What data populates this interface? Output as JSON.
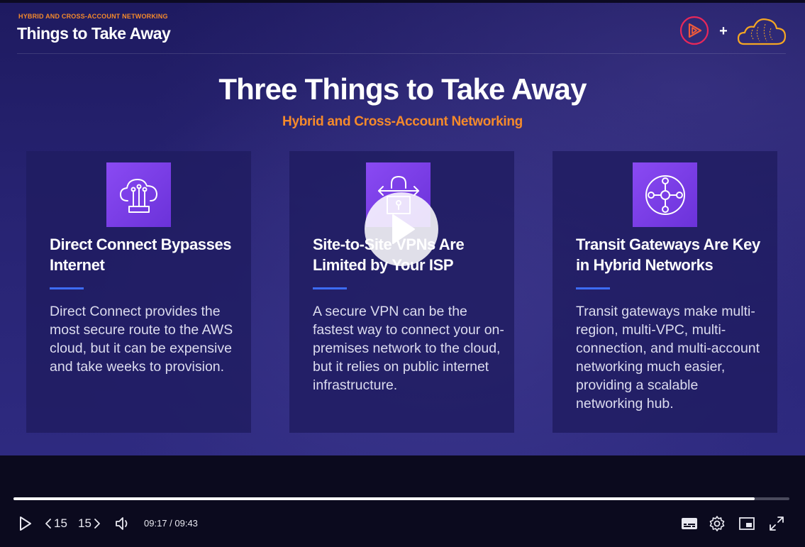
{
  "header": {
    "kicker": "HYBRID AND CROSS-ACCOUNT NETWORKING",
    "title": "Things to Take Away",
    "plus": "+",
    "logos": [
      "play-logo-icon",
      "cloud-logo-icon"
    ]
  },
  "slide": {
    "title": "Three Things to Take Away",
    "subtitle": "Hybrid and Cross-Account Networking",
    "accent_color": "#f58a2b",
    "icon_color": "#7c3aed",
    "cards": [
      {
        "icon": "cloud-connect-icon",
        "title": "Direct Connect Bypasses Internet",
        "body": "Direct Connect provides the most secure route to the AWS cloud, but it can be expensive and take weeks to provision."
      },
      {
        "icon": "vpn-lock-icon",
        "title": "Site-to-Site VPNs Are Limited by Your ISP",
        "body": "A secure VPN can be the fastest way to connect your on-premises network to the cloud, but it relies on public internet infrastructure."
      },
      {
        "icon": "transit-gateway-icon",
        "title": "Transit Gateways Are Key in Hybrid Networks",
        "body": "Transit gateways make multi-region, multi-VPC, multi-connection, and multi-account networking much easier, providing a scalable networking hub."
      }
    ]
  },
  "player": {
    "current_time": "09:17",
    "duration": "09:43",
    "time_display": "09:17 / 09:43",
    "progress_fraction": 0.9554,
    "skip_back_label": "15",
    "skip_forward_label": "15",
    "controls": [
      "play-icon",
      "skip-back-icon",
      "skip-forward-icon",
      "volume-icon",
      "captions-icon",
      "settings-icon",
      "picture-in-picture-icon",
      "fullscreen-icon"
    ]
  }
}
